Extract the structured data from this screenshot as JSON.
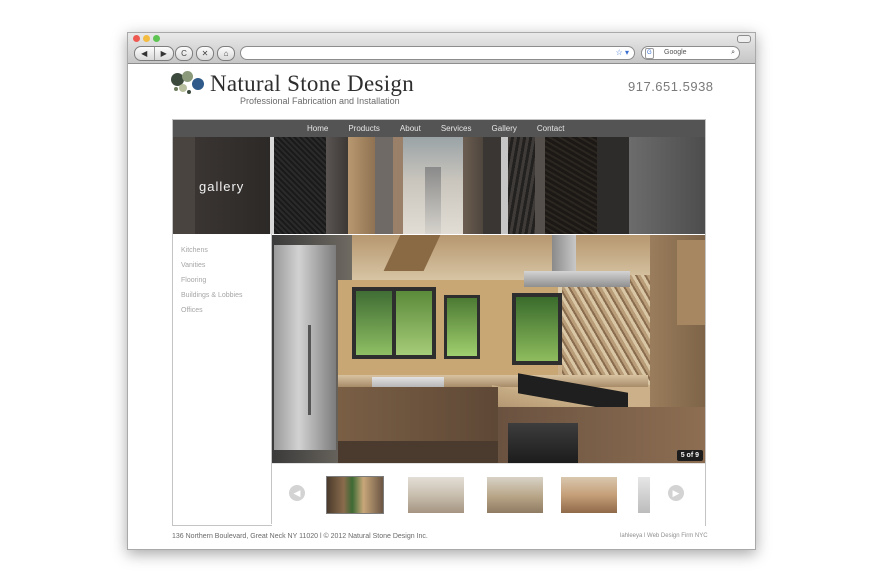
{
  "browser": {
    "back_label": "◀",
    "forward_label": "▶",
    "reload_label": "C",
    "stop_label": "✕",
    "home_label": "⌂",
    "search_placeholder": "Google",
    "search_engine_badge": "G",
    "icons": [
      "back-icon",
      "forward-icon",
      "reload-icon",
      "stop-icon",
      "home-icon",
      "bookmark-star-icon",
      "search-icon"
    ]
  },
  "site": {
    "brand": "Natural Stone Design",
    "tagline": "Professional Fabrication and Installation",
    "phone": "917.651.5938",
    "logo_colors": [
      "#3c4a3e",
      "#8a9a7a",
      "#2f5a8a",
      "#b7bf9e"
    ]
  },
  "nav": [
    "Home",
    "Products",
    "About",
    "Services",
    "Gallery",
    "Contact"
  ],
  "hero": {
    "label": "gallery"
  },
  "sidebar": [
    "Kitchens",
    "Vanities",
    "Flooring",
    "Buildings & Lobbies",
    "Offices"
  ],
  "gallery": {
    "counter": "5 of 9",
    "prev_label": "◀",
    "next_label": "▶",
    "active_thumb": 1
  },
  "footer": {
    "address": "136 Northern Boulevard, Great Neck NY 11020 l © 2012 Natural Stone Design Inc.",
    "credit": "lahleeya l Web Design Firm NYC"
  },
  "colors": {
    "nav_bg": "#545454",
    "sidebar_text": "#a6a6a6",
    "brand_text": "#2e2e2e"
  }
}
